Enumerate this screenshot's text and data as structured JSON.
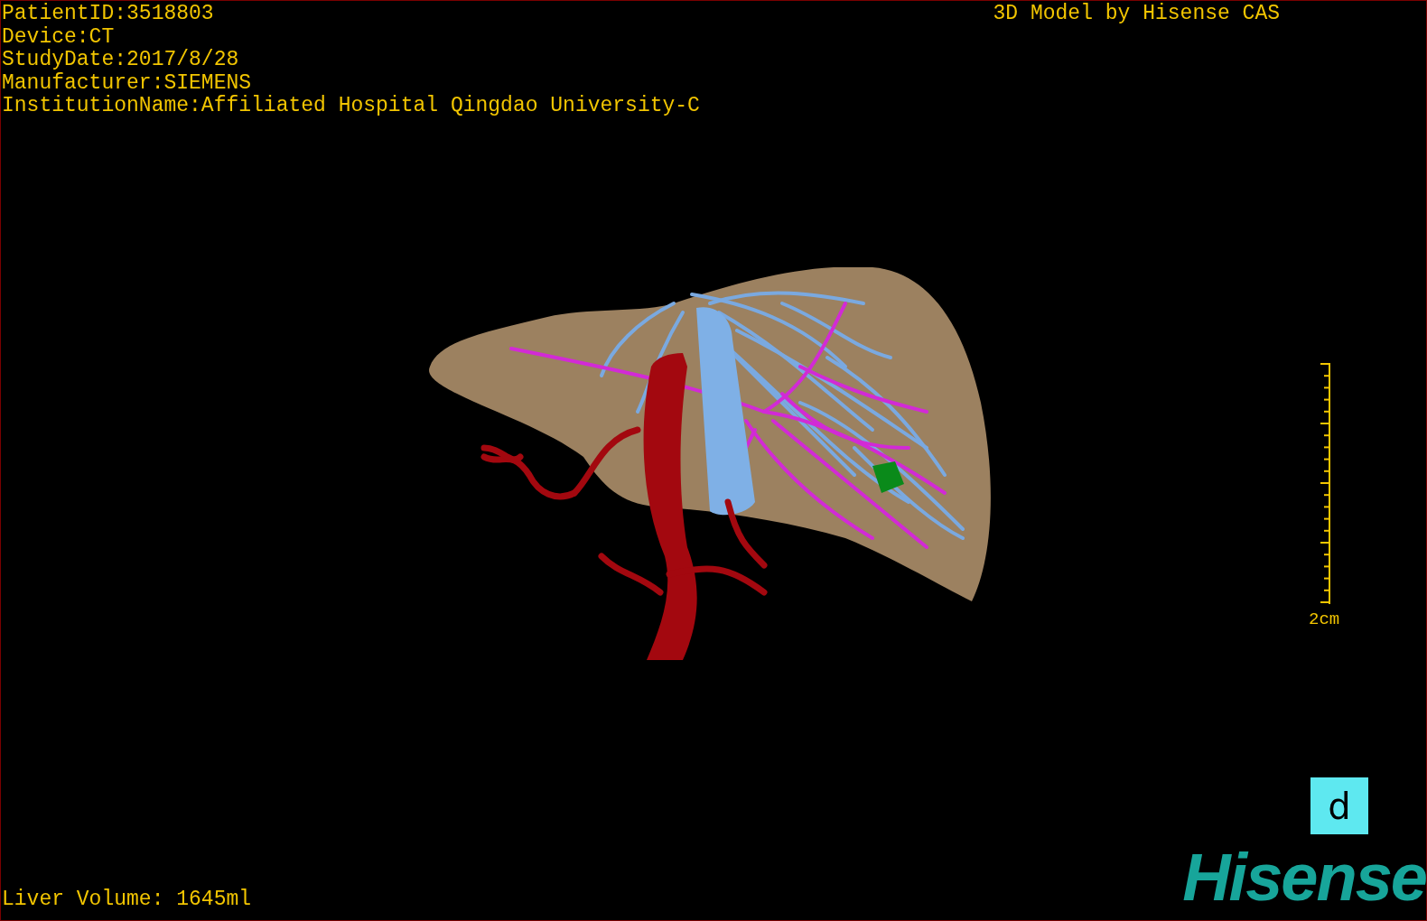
{
  "info_lines": [
    "PatientID:3518803",
    "Device:CT",
    "StudyDate:2017/8/28",
    "Manufacturer:SIEMENS",
    "InstitutionName:Affiliated Hospital Qingdao University-C"
  ],
  "model_credit": "3D Model by Hisense CAS",
  "scale_bar": {
    "label": "2cm"
  },
  "orientation_marker": "d",
  "liver_volume": "Liver Volume: 1645ml",
  "logo": "Hisense"
}
